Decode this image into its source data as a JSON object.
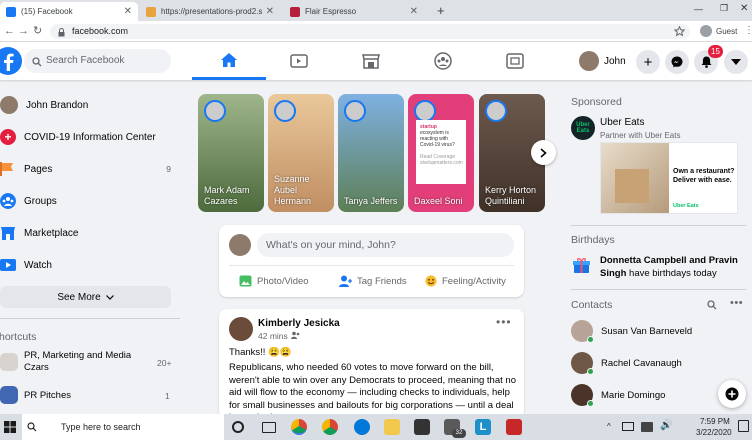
{
  "browser": {
    "tabs": [
      {
        "title": "(15) Facebook",
        "active": true,
        "favicon_color": "#1877f2"
      },
      {
        "title": "https://presentations-prod2.spri",
        "active": false,
        "favicon_color": "#e8a33d"
      },
      {
        "title": "Flair Espresso",
        "active": false,
        "favicon_color": "#b5203a"
      }
    ],
    "new_tab": "+",
    "url": "facebook.com",
    "profile": "Guest"
  },
  "header": {
    "search_placeholder": "Search Facebook",
    "user_name": "John",
    "notifications_badge": "15",
    "brand_color": "#1877f2"
  },
  "sidebar": {
    "items": [
      {
        "label": "John Brandon",
        "icon": "avatar",
        "count": ""
      },
      {
        "label": "COVID-19 Information Center",
        "icon": "covid-icon",
        "count": ""
      },
      {
        "label": "Pages",
        "icon": "flag-icon",
        "count": "9"
      },
      {
        "label": "Groups",
        "icon": "groups-icon",
        "count": ""
      },
      {
        "label": "Marketplace",
        "icon": "marketplace-icon",
        "count": ""
      },
      {
        "label": "Watch",
        "icon": "watch-icon",
        "count": ""
      }
    ],
    "see_more": "See More",
    "shortcuts_title": "hortcuts",
    "shortcuts": [
      {
        "label": "PR, Marketing and Media Czars",
        "count": "20+"
      },
      {
        "label": "PR Pitches",
        "count": "1"
      }
    ]
  },
  "stories": [
    {
      "name": "Mark Adam Cazares"
    },
    {
      "name": "Suzanne Aubel Hermann"
    },
    {
      "name": "Tanya Jeffers"
    },
    {
      "name": "Daxeel Soni"
    },
    {
      "name": "Kerry Horton Quintiliani"
    }
  ],
  "story_card_text": {
    "startup": "startup",
    "ecosystem": "ecosystem is reacting with Covid-19 virus?",
    "footer": "Read Coverage startupmatters.com"
  },
  "composer": {
    "placeholder": "What's on your mind, John?",
    "actions": [
      "Photo/Video",
      "Tag Friends",
      "Feeling/Activity"
    ]
  },
  "post": {
    "author": "Kimberly Jesicka",
    "time": "42 mins",
    "line1": "Thanks!! 😩😩",
    "body": "Republicans, who needed 60 votes to move forward on the bill, weren't able to win over any Democrats to proceed, meaning that no aid will flow to the economy — including checks to individuals, help for small businesses and bailouts for big corporations — until a deal is reached."
  },
  "right": {
    "sponsored_title": "Sponsored",
    "ad_name": "Uber Eats",
    "ad_sub": "Partner with Uber Eats",
    "ad_headline": "Own a restaurant? Deliver with ease.",
    "ad_brand": "Uber Eats",
    "birthdays_title": "Birthdays",
    "birthday_names": "Donnetta Campbell and Pravin Singh",
    "birthday_suffix": "have birthdays today",
    "contacts_title": "Contacts",
    "contacts": [
      "Susan Van Barneveld",
      "Rachel Cavanaugh",
      "Marie Domingo"
    ]
  },
  "taskbar": {
    "search_placeholder": "Type here to search",
    "time": "7:59 PM",
    "date": "3/22/2020",
    "badge": "32"
  }
}
